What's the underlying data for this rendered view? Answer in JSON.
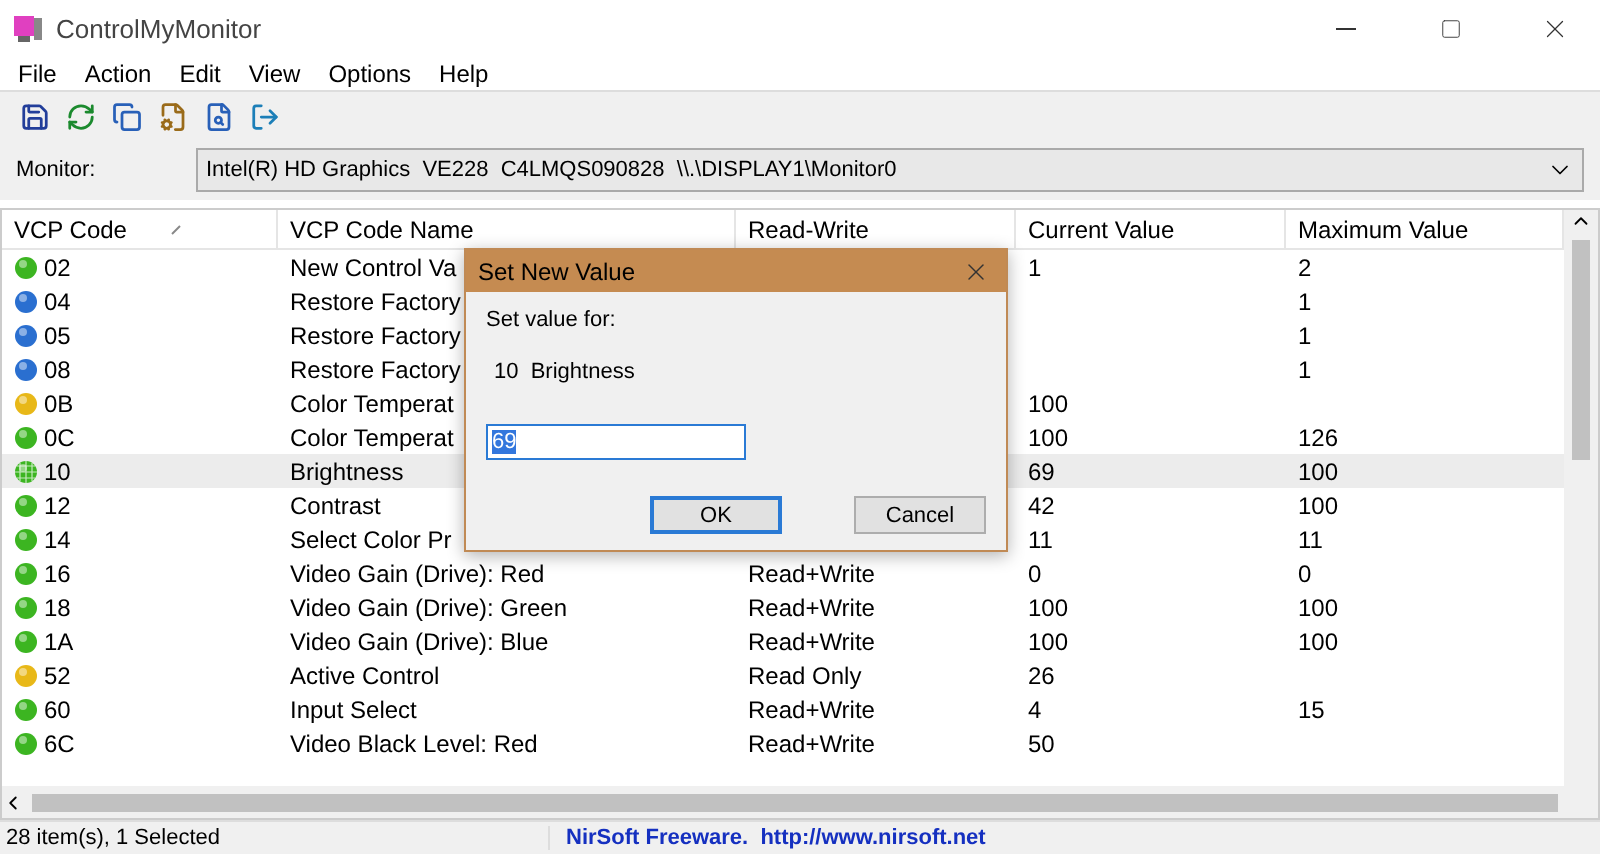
{
  "window": {
    "title": "ControlMyMonitor"
  },
  "menu": [
    "File",
    "Action",
    "Edit",
    "View",
    "Options",
    "Help"
  ],
  "monitor": {
    "label": "Monitor:",
    "value": "Intel(R) HD Graphics  VE228  C4LMQS090828  \\\\.\\DISPLAY1\\Monitor0"
  },
  "table": {
    "columns": [
      "VCP Code",
      "VCP Code Name",
      "Read-Write",
      "Current Value",
      "Maximum Value"
    ],
    "rows": [
      {
        "code": "02",
        "color": "#3cb521",
        "name": "New Control Va",
        "current": "1",
        "maximum": "2",
        "selected": false
      },
      {
        "code": "04",
        "color": "#2a6fd0",
        "name": "Restore Factory",
        "maximum": "1",
        "selected": false
      },
      {
        "code": "05",
        "color": "#2a6fd0",
        "name": "Restore Factory",
        "maximum": "1",
        "selected": false
      },
      {
        "code": "08",
        "color": "#2a6fd0",
        "name": "Restore Factory",
        "maximum": "1",
        "selected": false
      },
      {
        "code": "0B",
        "color": "#e8b818",
        "name": "Color Temperat",
        "current": "100",
        "selected": false
      },
      {
        "code": "0C",
        "color": "#3cb521",
        "name": "Color Temperat",
        "current": "100",
        "maximum": "126",
        "selected": false
      },
      {
        "code": "10",
        "color": "#3cb521",
        "name": "Brightness",
        "current": "69",
        "maximum": "100",
        "selected": true
      },
      {
        "code": "12",
        "color": "#3cb521",
        "name": "Contrast",
        "current": "42",
        "maximum": "100",
        "selected": false
      },
      {
        "code": "14",
        "color": "#3cb521",
        "name": "Select Color Pr",
        "current": "11",
        "maximum": "11",
        "selected": false
      },
      {
        "code": "16",
        "color": "#3cb521",
        "name": "Video Gain (Drive): Red",
        "access": "Read+Write",
        "current": "0",
        "maximum": "0",
        "selected": false
      },
      {
        "code": "18",
        "color": "#3cb521",
        "name": "Video Gain (Drive): Green",
        "access": "Read+Write",
        "current": "100",
        "maximum": "100",
        "selected": false
      },
      {
        "code": "1A",
        "color": "#3cb521",
        "name": "Video Gain (Drive): Blue",
        "access": "Read+Write",
        "current": "100",
        "maximum": "100",
        "selected": false
      },
      {
        "code": "52",
        "color": "#e8b818",
        "name": "Active Control",
        "access": "Read Only",
        "current": "26",
        "selected": false
      },
      {
        "code": "60",
        "color": "#3cb521",
        "name": "Input Select",
        "access": "Read+Write",
        "current": "4",
        "maximum": "15",
        "selected": false
      },
      {
        "code": "6C",
        "color": "#3cb521",
        "name": "Video Black Level: Red",
        "access": "Read+Write",
        "current": "50",
        "selected": false
      }
    ]
  },
  "dialog": {
    "title": "Set New Value",
    "prompt": "Set value for:",
    "item": "10  Brightness",
    "value": "69",
    "buttons": [
      "OK",
      "Cancel"
    ]
  },
  "status_bar": {
    "items": "28 item(s), 1 Selected",
    "credit": "NirSoft Freeware.  http://www.nirsoft.net"
  }
}
